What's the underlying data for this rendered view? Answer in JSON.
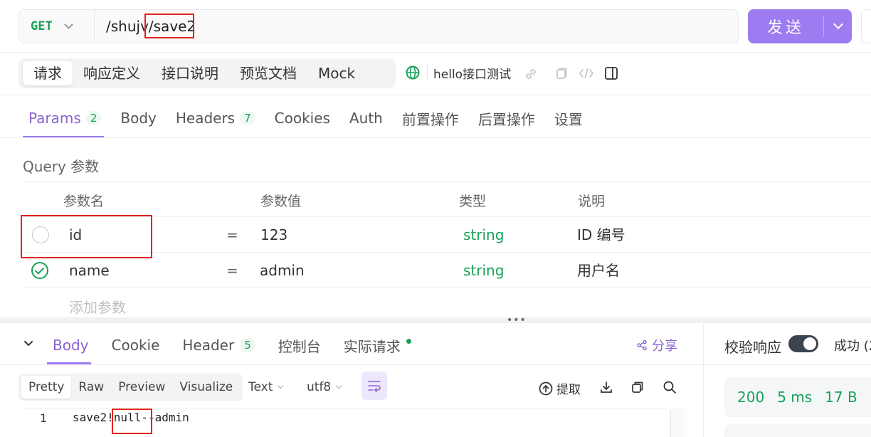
{
  "request": {
    "method": "GET",
    "url": "/shujv/save2",
    "send_label": "发送"
  },
  "segment_tabs": [
    "请求",
    "响应定义",
    "接口说明",
    "预览文档",
    "Mock"
  ],
  "env_name": "hello接口测试",
  "sub_tabs": [
    {
      "label": "Params",
      "count": "2"
    },
    {
      "label": "Body"
    },
    {
      "label": "Headers",
      "count": "7"
    },
    {
      "label": "Cookies"
    },
    {
      "label": "Auth"
    },
    {
      "label": "前置操作"
    },
    {
      "label": "后置操作"
    },
    {
      "label": "设置"
    }
  ],
  "query": {
    "title": "Query 参数",
    "headers": [
      "参数名",
      "参数值",
      "类型",
      "说明"
    ],
    "rows": [
      {
        "name": "id",
        "eq": "=",
        "value": "123",
        "type": "string",
        "desc": "ID 编号",
        "enabled": false
      },
      {
        "name": "name",
        "eq": "=",
        "value": "admin",
        "type": "string",
        "desc": "用户名",
        "enabled": true
      }
    ],
    "add_placeholder": "添加参数"
  },
  "response": {
    "tabs": [
      {
        "label": "Body"
      },
      {
        "label": "Cookie"
      },
      {
        "label": "Header",
        "count": "5"
      },
      {
        "label": "控制台"
      },
      {
        "label": "实际请求"
      }
    ],
    "share_label": "分享",
    "verify_label": "校验响应",
    "success_label": "成功 (2",
    "formats": [
      "Pretty",
      "Raw",
      "Preview",
      "Visualize"
    ],
    "content_type": "Text",
    "encoding": "utf8",
    "extract_label": "提取",
    "status": "200",
    "time": "5 ms",
    "size": "17 B",
    "code_line_number": "1",
    "code_line": "save2!null--admin"
  },
  "colors": {
    "accent": "#9c7cf0",
    "green": "#18a058",
    "highlight": "#e0231c"
  }
}
